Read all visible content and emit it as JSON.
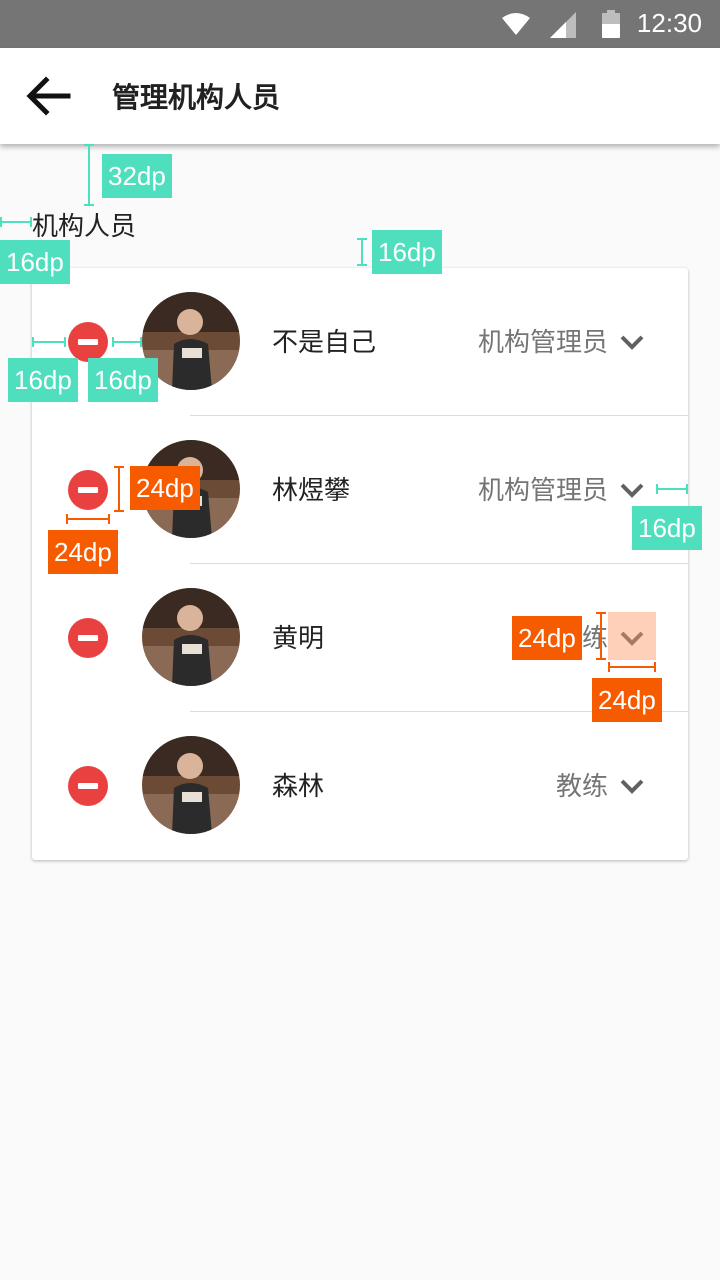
{
  "status_bar": {
    "time": "12:30",
    "icons": [
      "wifi-icon",
      "signal-icon",
      "battery-icon"
    ]
  },
  "app_bar": {
    "back_icon": "arrow-left-icon",
    "title": "管理机构人员"
  },
  "section": {
    "label": "机构人员"
  },
  "members": [
    {
      "name": "不是自己",
      "role": "机构管理员"
    },
    {
      "name": "林煜攀",
      "role": "机构管理员"
    },
    {
      "name": "黄明",
      "role": "教练"
    },
    {
      "name": "森林",
      "role": "教练"
    }
  ],
  "annotations": {
    "top_gap": "32dp",
    "left_margin": "16dp",
    "card_gap": "16dp",
    "remove_left": "16dp",
    "remove_right": "16dp",
    "remove_height": "24dp",
    "remove_width": "24dp",
    "chevron_right": "16dp",
    "chevron_height": "24dp",
    "chevron_width": "24dp"
  },
  "colors": {
    "remove": "#e94040",
    "annotation_teal": "#4fdfbf",
    "annotation_orange": "#f75b00"
  }
}
